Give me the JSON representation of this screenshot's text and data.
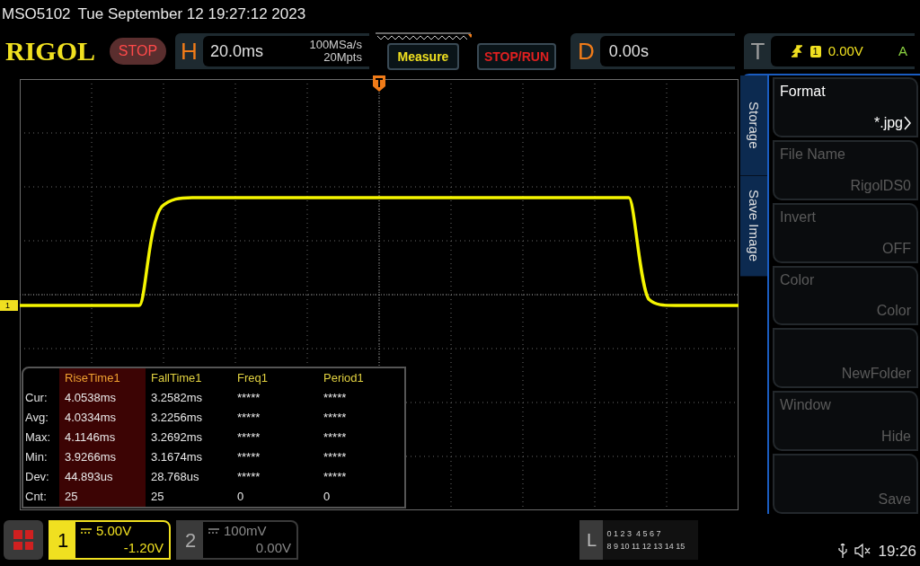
{
  "status": {
    "model": "MSO5102",
    "datetime": "Tue September 12 19:27:12 2023"
  },
  "logo": "RIGOL",
  "run_state": "STOP",
  "horizontal": {
    "label": "H",
    "timebase": "20.0ms",
    "sample_rate": "100MSa/s",
    "memory_depth": "20Mpts"
  },
  "buttons": [
    {
      "label": "Measure",
      "kind": "measure"
    },
    {
      "label": "STOP/RUN",
      "kind": "stoprun"
    }
  ],
  "delay": {
    "label": "D",
    "value": "0.00s"
  },
  "trigger": {
    "label": "T",
    "source": "1",
    "level": "0.00V",
    "mode": "A"
  },
  "channel_marker": "1",
  "measurements": {
    "columns": [
      {
        "name": "RiseTime1",
        "selected": true
      },
      {
        "name": "FallTime1",
        "selected": false
      },
      {
        "name": "Freq1",
        "selected": false
      },
      {
        "name": "Period1",
        "selected": false
      }
    ],
    "rows": [
      {
        "label": "Cur:",
        "values": [
          "4.0538ms",
          "3.2582ms",
          "*****",
          "*****"
        ]
      },
      {
        "label": "Avg:",
        "values": [
          "4.0334ms",
          "3.2256ms",
          "*****",
          "*****"
        ]
      },
      {
        "label": "Max:",
        "values": [
          "4.1146ms",
          "3.2692ms",
          "*****",
          "*****"
        ]
      },
      {
        "label": "Min:",
        "values": [
          "3.9266ms",
          "3.1674ms",
          "*****",
          "*****"
        ]
      },
      {
        "label": "Dev:",
        "values": [
          "44.893us",
          "28.768us",
          "*****",
          "*****"
        ]
      },
      {
        "label": "Cnt:",
        "values": [
          "25",
          "25",
          "0",
          "0"
        ]
      }
    ]
  },
  "side_tabs": [
    {
      "label": "Storage"
    },
    {
      "label": "Save Image"
    }
  ],
  "menu": [
    {
      "label": "Format",
      "value": "*.jpg",
      "disabled": false,
      "submenu": true
    },
    {
      "label": "File Name",
      "value": "RigolDS0",
      "disabled": true,
      "submenu": false
    },
    {
      "label": "Invert",
      "value": "OFF",
      "disabled": true,
      "submenu": false
    },
    {
      "label": "Color",
      "value": "Color",
      "disabled": true,
      "submenu": false
    },
    {
      "value": "NewFolder",
      "disabled": true,
      "submenu": false
    },
    {
      "label": "Window",
      "value": "Hide",
      "disabled": true,
      "submenu": false
    },
    {
      "value": "Save",
      "disabled": true,
      "submenu": false
    }
  ],
  "channels": [
    {
      "number": "1",
      "scale": "5.00V",
      "offset": "-1.20V",
      "selected": true
    },
    {
      "number": "2",
      "scale": "100mV",
      "offset": "0.00V",
      "selected": false
    }
  ],
  "logic": {
    "label": "L",
    "rows": [
      "0 1 2 3  4 5 6 7",
      "8 9 10 11 12 13 14 15"
    ]
  },
  "clock": "19:26"
}
